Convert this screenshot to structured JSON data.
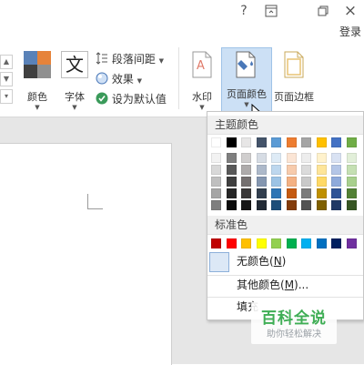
{
  "titlebar": {
    "help_icon": "?",
    "ribbon_display_icon": "ribbon-display-options",
    "restore_icon": "restore-window",
    "close_icon": "×",
    "login_label": "登录"
  },
  "ribbon": {
    "colors_label": "颜色",
    "fonts_label": "字体",
    "fonts_glyph": "文",
    "paragraph_spacing_label": "段落间距",
    "effects_label": "效果",
    "set_default_label": "设为默认值",
    "watermark_label": "水印",
    "page_color_label": "页面颜色",
    "page_borders_label": "页面边框",
    "theme_swatch_colors": [
      "#5a82b8",
      "#e6833a",
      "#404040",
      "#909090"
    ]
  },
  "dropdown": {
    "theme_colors_label": "主题颜色",
    "theme_colors_top": [
      "#ffffff",
      "#000000",
      "#e7e6e6",
      "#44546a",
      "#5b9bd5",
      "#ed7d31",
      "#a5a5a5",
      "#ffc000",
      "#4472c4",
      "#70ad47"
    ],
    "theme_colors_shades": [
      [
        "#f2f2f2",
        "#7f7f7f",
        "#d0cece",
        "#d6dce4",
        "#deebf6",
        "#fbe5d5",
        "#ededed",
        "#fff2cc",
        "#d9e2f3",
        "#e2efd9"
      ],
      [
        "#d8d8d8",
        "#595959",
        "#aeabab",
        "#adb9ca",
        "#bdd7ee",
        "#f7cbac",
        "#dbdbdb",
        "#fee599",
        "#b4c6e7",
        "#c5e0b3"
      ],
      [
        "#bfbfbf",
        "#3f3f3f",
        "#757070",
        "#8496b0",
        "#9cc3e5",
        "#f4b183",
        "#c9c9c9",
        "#ffd965",
        "#8eaadb",
        "#a8d08d"
      ],
      [
        "#a5a5a5",
        "#262626",
        "#3a3838",
        "#323f4f",
        "#2e75b5",
        "#c55a11",
        "#7b7b7b",
        "#bf9000",
        "#2f5496",
        "#538135"
      ],
      [
        "#7f7f7f",
        "#0c0c0c",
        "#171616",
        "#222a35",
        "#1e4e79",
        "#833c0b",
        "#525252",
        "#7f6000",
        "#1f3864",
        "#375623"
      ]
    ],
    "standard_colors_label": "标准色",
    "standard_colors": [
      "#c00000",
      "#ff0000",
      "#ffc000",
      "#ffff00",
      "#92d050",
      "#00b050",
      "#00b0f0",
      "#0070c0",
      "#002060",
      "#7030a0"
    ],
    "no_color_label": "无颜色(",
    "no_color_key": "N",
    "no_color_close": ")",
    "more_colors_label": "其他颜色(",
    "more_colors_key": "M",
    "more_colors_close": ")...",
    "fill_effects_label": "填充"
  },
  "watermark": {
    "title": "百科全说",
    "subtitle": "助你轻松解决"
  }
}
